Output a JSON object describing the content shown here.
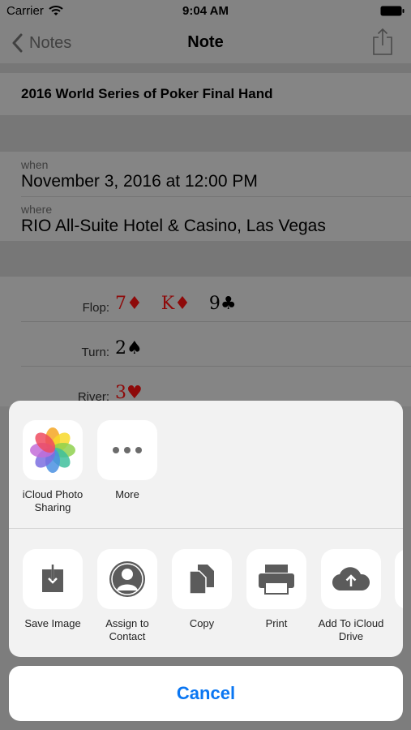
{
  "status_bar": {
    "carrier": "Carrier",
    "time": "9:04 AM"
  },
  "nav": {
    "back_label": "Notes",
    "title": "Note"
  },
  "note": {
    "title": "2016 World Series of Poker Final Hand",
    "when_label": "when",
    "when_value": "November 3, 2016 at 12:00 PM",
    "where_label": "where",
    "where_value": "RIO All-Suite Hotel & Casino, Las Vegas"
  },
  "hand": [
    {
      "label": "Flop:",
      "cards": [
        {
          "text": "7♦",
          "color": "red"
        },
        {
          "text": "K♦",
          "color": "red"
        },
        {
          "text": "9♣",
          "color": "black"
        }
      ]
    },
    {
      "label": "Turn:",
      "cards": [
        {
          "text": "2♠",
          "color": "black"
        }
      ]
    },
    {
      "label": "River:",
      "cards": [
        {
          "text": "3♥",
          "color": "red"
        }
      ]
    }
  ],
  "share_sheet": {
    "apps": [
      {
        "label": "iCloud Photo Sharing",
        "icon": "photos-icon"
      },
      {
        "label": "More",
        "icon": "more-icon"
      }
    ],
    "actions": [
      {
        "label": "Save Image",
        "icon": "save-image-icon"
      },
      {
        "label": "Assign to Contact",
        "icon": "contact-icon"
      },
      {
        "label": "Copy",
        "icon": "copy-icon"
      },
      {
        "label": "Print",
        "icon": "print-icon"
      },
      {
        "label": "Add To iCloud Drive",
        "icon": "icloud-drive-icon"
      }
    ],
    "cancel_label": "Cancel"
  },
  "colors": {
    "accent": "#0a76f2",
    "card_red": "#c0161a",
    "sheet_bg": "#f2f2f2"
  }
}
